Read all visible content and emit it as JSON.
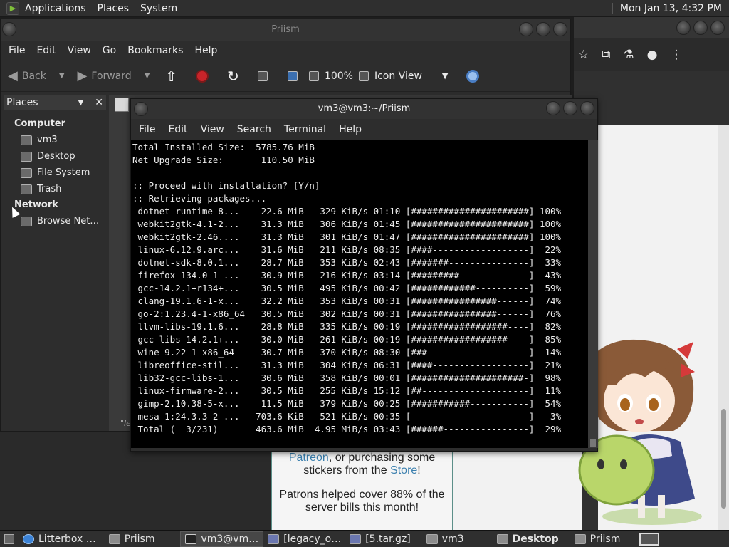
{
  "top_panel": {
    "menus": [
      "Applications",
      "Places",
      "System"
    ],
    "clock": "Mon Jan 13,  4:32 PM"
  },
  "file_manager": {
    "title": "Priism",
    "menu": [
      "File",
      "Edit",
      "View",
      "Go",
      "Bookmarks",
      "Help"
    ],
    "toolbar": {
      "back_label": "Back",
      "forward_label": "Forward",
      "zoom": "100%",
      "view_mode": "Icon View"
    },
    "sidebar": {
      "header": "Places",
      "computer_label": "Computer",
      "computer_items": [
        "vm3",
        "Desktop",
        "File System",
        "Trash"
      ],
      "network_label": "Network",
      "network_items": [
        "Browse Net…"
      ]
    },
    "status_fragment": "\"le"
  },
  "terminal": {
    "title": "vm3@vm3:~/Priism",
    "menu": [
      "File",
      "Edit",
      "View",
      "Search",
      "Terminal",
      "Help"
    ],
    "lines": [
      "Total Installed Size:  5785.76 MiB",
      "Net Upgrade Size:       110.50 MiB",
      "",
      ":: Proceed with installation? [Y/n]",
      ":: Retrieving packages...",
      " dotnet-runtime-8...    22.6 MiB   329 KiB/s 01:10 [######################] 100%",
      " webkit2gtk-4.1-2...    31.3 MiB   306 KiB/s 01:45 [######################] 100%",
      " webkit2gtk-2.46....    31.3 MiB   301 KiB/s 01:47 [######################] 100%",
      " linux-6.12.9.arc...    31.6 MiB   211 KiB/s 08:35 [####------------------]  22%",
      " dotnet-sdk-8.0.1...    28.7 MiB   353 KiB/s 02:43 [#######---------------]  33%",
      " firefox-134.0-1-...    30.9 MiB   216 KiB/s 03:14 [#########-------------]  43%",
      " gcc-14.2.1+r134+...    30.5 MiB   495 KiB/s 00:42 [############----------]  59%",
      " clang-19.1.6-1-x...    32.2 MiB   353 KiB/s 00:31 [################------]  74%",
      " go-2:1.23.4-1-x86_64   30.5 MiB   302 KiB/s 00:31 [################------]  76%",
      " llvm-libs-19.1.6...    28.8 MiB   335 KiB/s 00:19 [##################----]  82%",
      " gcc-libs-14.2.1+...    30.0 MiB   261 KiB/s 00:19 [##################----]  85%",
      " wine-9.22-1-x86_64     30.7 MiB   370 KiB/s 08:30 [###-------------------]  14%",
      " libreoffice-stil...    31.3 MiB   304 KiB/s 06:31 [####------------------]  21%",
      " lib32-gcc-libs-1...    30.6 MiB   358 KiB/s 00:01 [#####################-]  98%",
      " linux-firmware-2...    30.5 MiB   255 KiB/s 15:12 [##--------------------]  11%",
      " gimp-2.10.38-5-x...    11.5 MiB   379 KiB/s 00:25 [###########-----------]  54%",
      " mesa-1:24.3.3-2-...   703.6 KiB   521 KiB/s 00:35 [----------------------]   3%",
      " Total (  3/231)       463.6 MiB  4.95 MiB/s 03:43 [######----------------]  29%"
    ]
  },
  "browser_page": {
    "line1_prefix": "",
    "line2_link": "Patreon",
    "line2_rest": ", or purchasing some",
    "line3_prefix": "stickers from the ",
    "line3_link": "Store",
    "line3_suffix": "!",
    "line4": "Patrons helped cover 88% of the",
    "line5": "server bills this month!"
  },
  "taskbar": {
    "tasks": [
      {
        "label": "Litterbox …",
        "icon": "globe-icon"
      },
      {
        "label": "Priism",
        "icon": "folder-icon"
      },
      {
        "label": "vm3@vm…",
        "icon": "terminal-icon"
      },
      {
        "label": "[legacy_o…",
        "icon": "document-icon"
      },
      {
        "label": "[5.tar.gz]",
        "icon": "document-icon"
      },
      {
        "label": "vm3",
        "icon": "folder-icon"
      },
      {
        "label": "Desktop",
        "icon": "folder-icon"
      },
      {
        "label": "Priism",
        "icon": "folder-icon"
      }
    ]
  },
  "colors": {
    "accent_link": "#3a7fae",
    "stop_red": "#c8242a"
  }
}
